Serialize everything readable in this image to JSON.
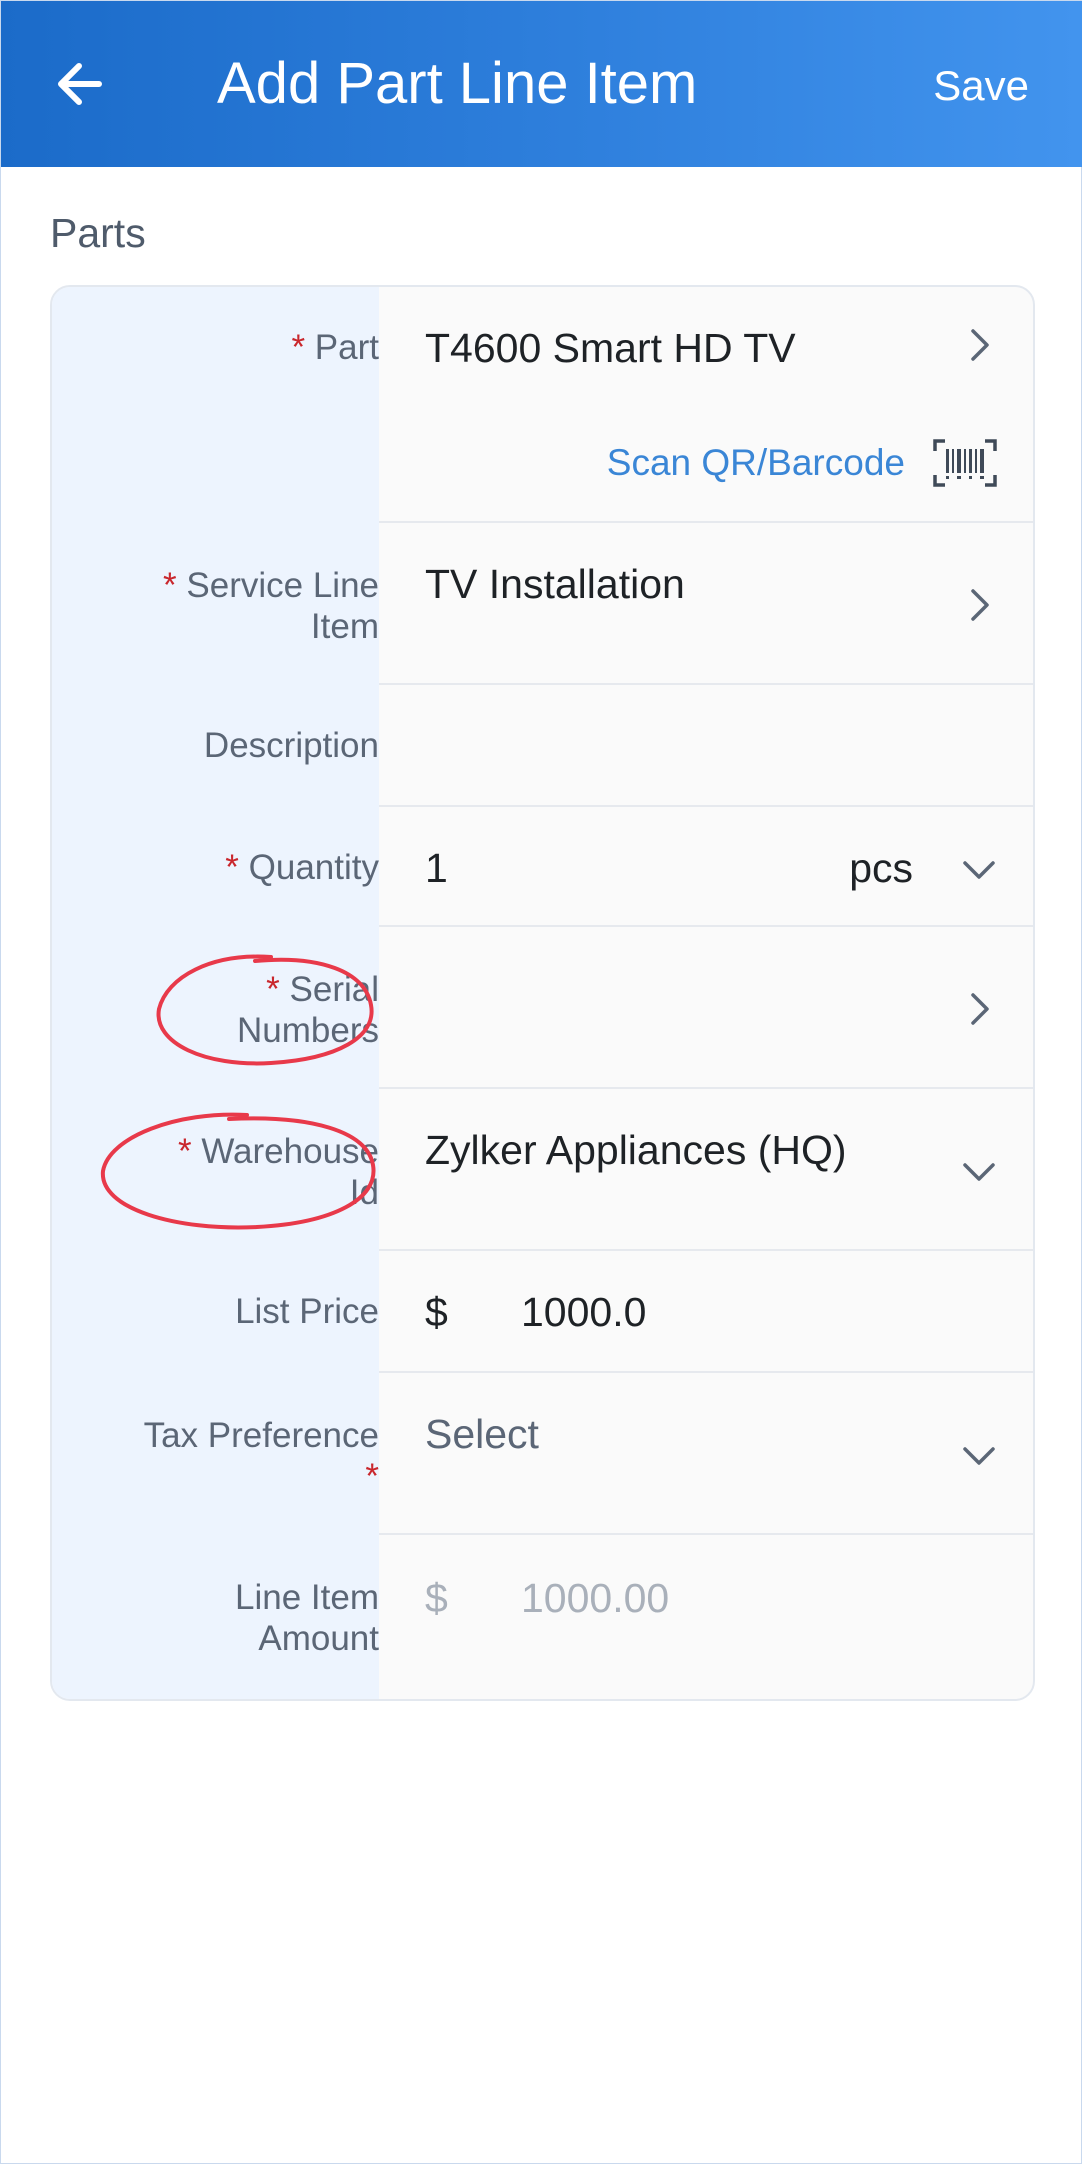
{
  "header": {
    "title": "Add Part Line Item",
    "save_label": "Save"
  },
  "section": {
    "title": "Parts"
  },
  "fields": {
    "part": {
      "label": "Part",
      "value": "T4600 Smart HD TV",
      "scan_label": "Scan QR/Barcode"
    },
    "service_line_item": {
      "label_line1": "Service Line",
      "label_line2": "Item",
      "value": "TV Installation"
    },
    "description": {
      "label": "Description",
      "value": ""
    },
    "quantity": {
      "label": "Quantity",
      "value": "1",
      "unit": "pcs"
    },
    "serial_numbers": {
      "label_line1": "Serial",
      "label_line2": "Numbers",
      "value": ""
    },
    "warehouse_id": {
      "label_line1": "Warehouse",
      "label_line2": "Id",
      "value": "Zylker Appliances (HQ)"
    },
    "list_price": {
      "label": "List Price",
      "currency": "$",
      "value": "1000.0"
    },
    "tax_preference": {
      "label": "Tax Preference",
      "placeholder": "Select"
    },
    "line_item_amount": {
      "label_line1": "Line Item",
      "label_line2": "Amount",
      "currency": "$",
      "value": "1000.00"
    }
  },
  "required_marker": "*",
  "colors": {
    "header_start": "#1b6bc9",
    "header_end": "#4294ee",
    "required": "#c9272d",
    "link": "#3a86d6",
    "annotation": "#e8394a"
  }
}
